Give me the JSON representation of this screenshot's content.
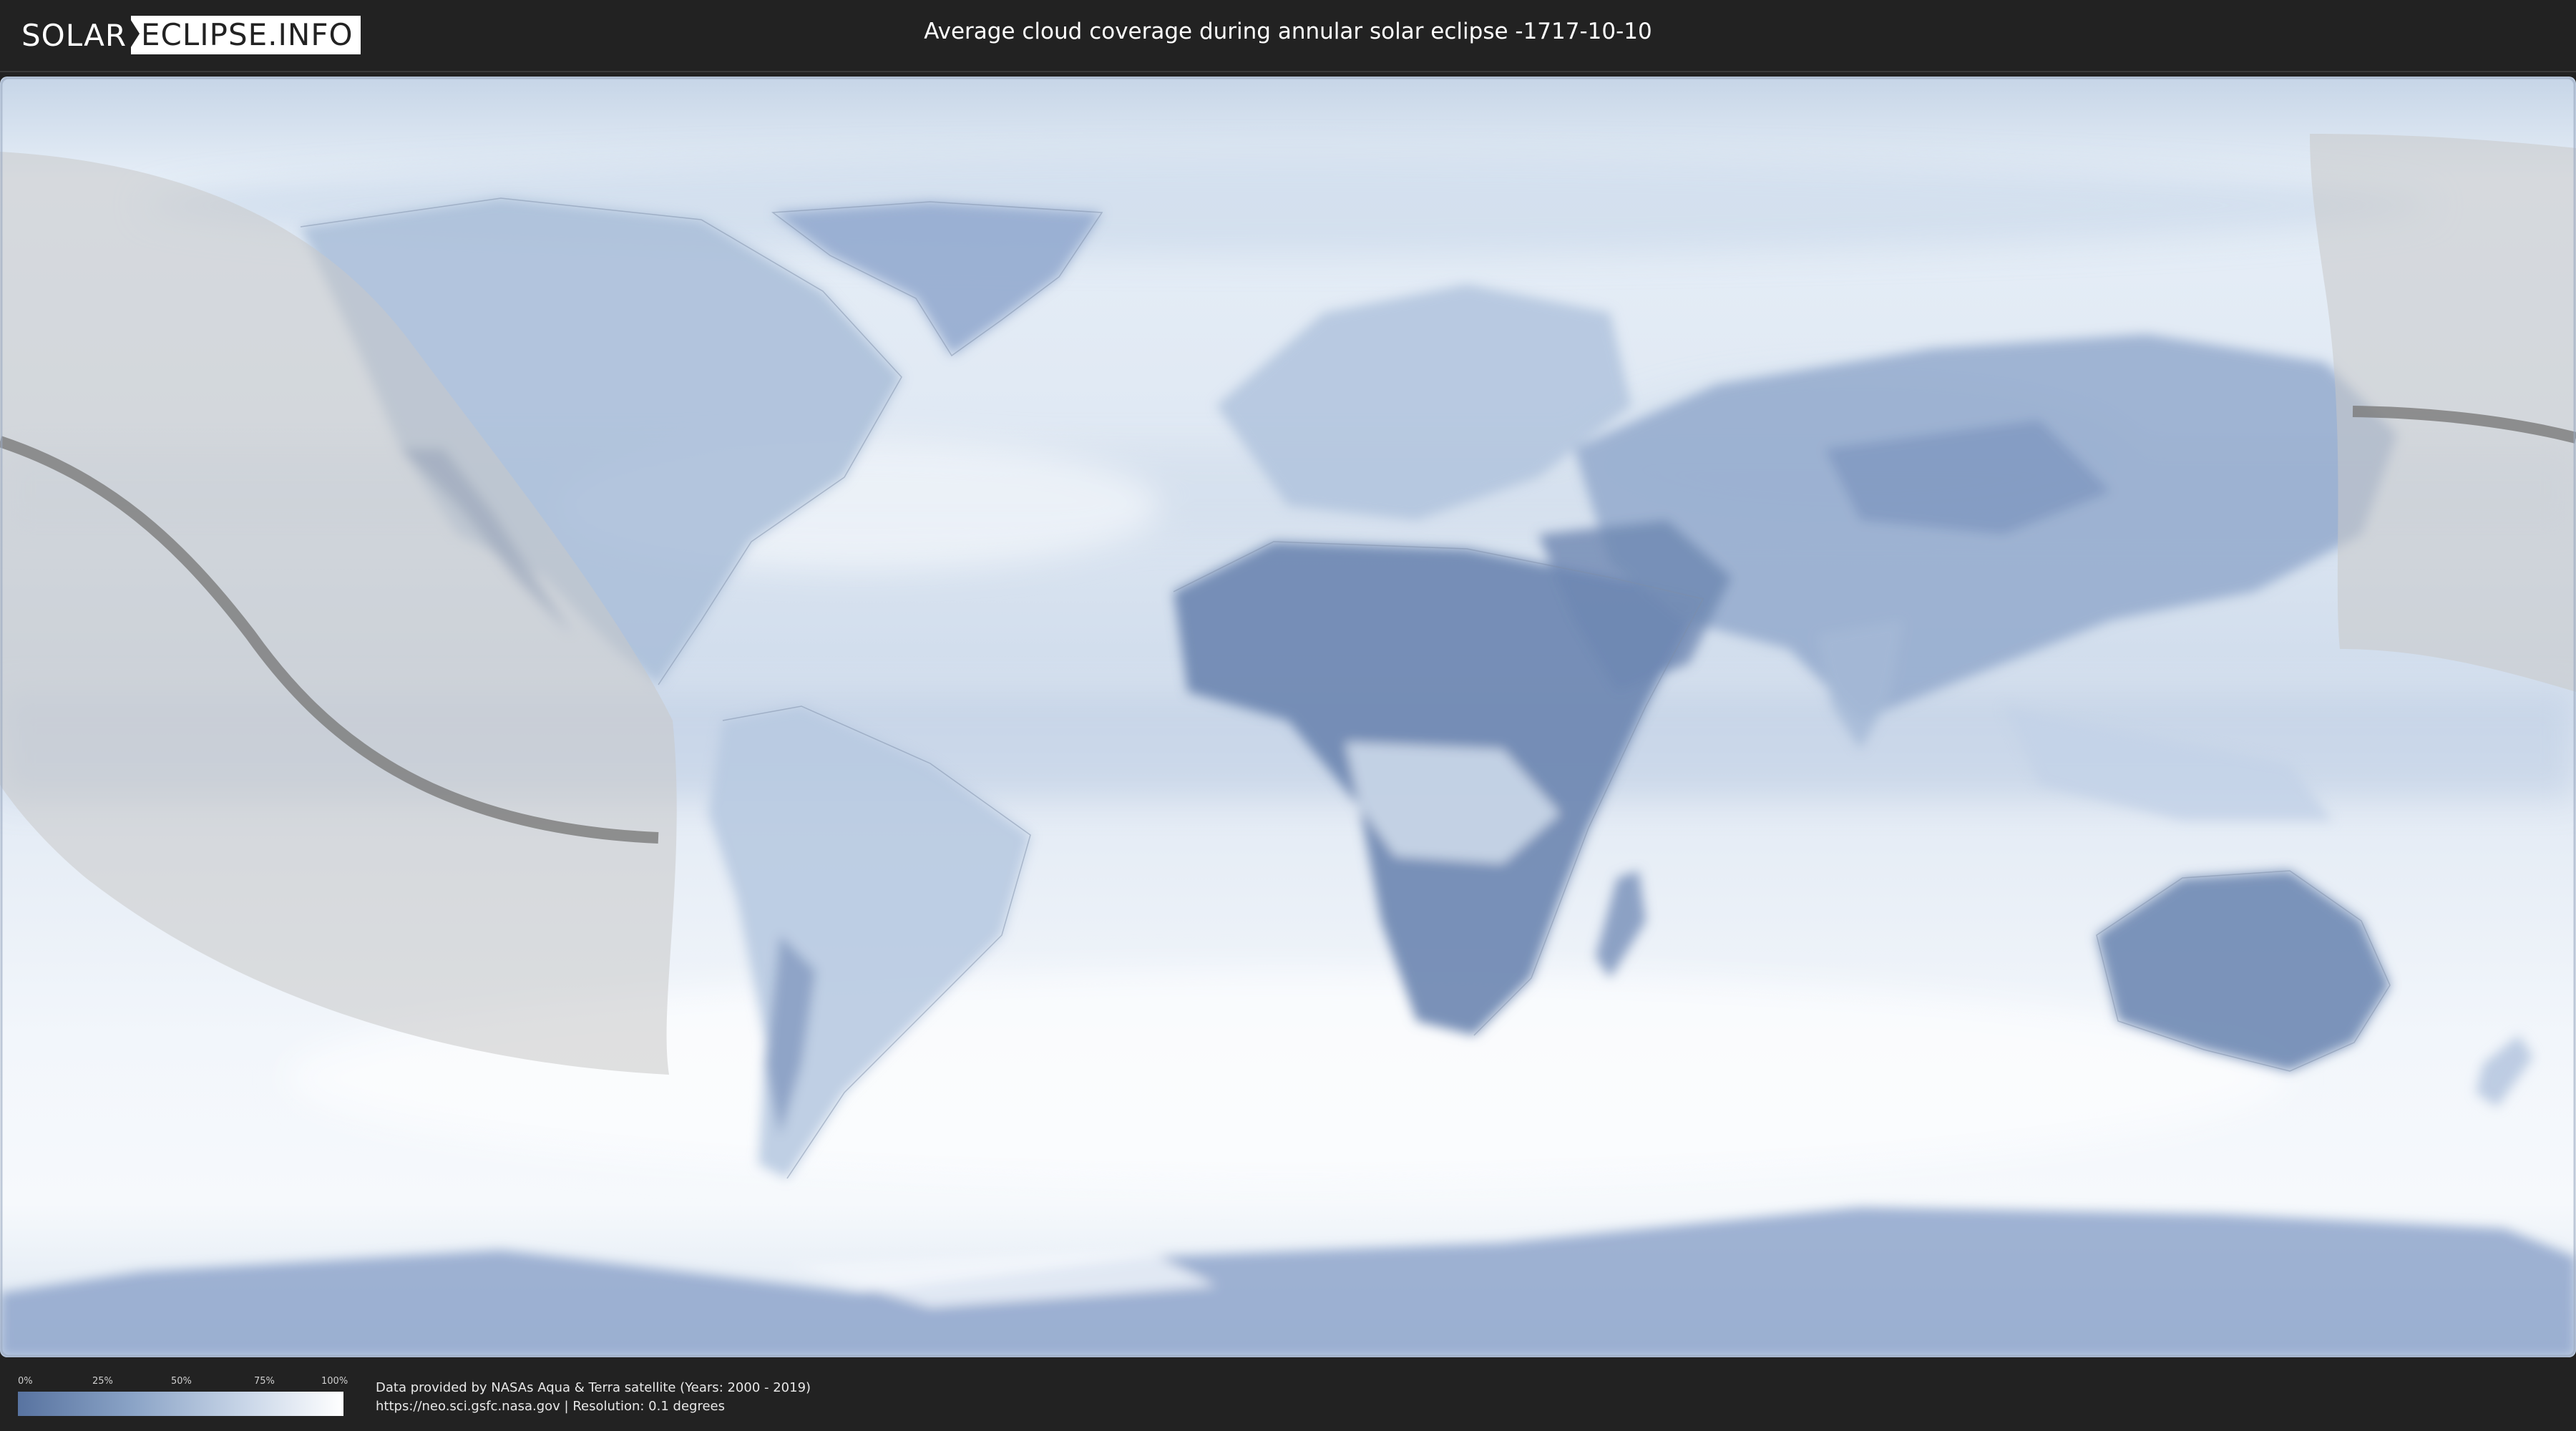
{
  "header": {
    "logo_part1": "SOLAR",
    "logo_part2": "ECLIPSE.INFO",
    "title": "Average cloud coverage during annular solar eclipse -1717-10-10"
  },
  "legend": {
    "ticks": [
      "0%",
      "25%",
      "50%",
      "75%",
      "100%"
    ],
    "colors": {
      "low": "#5873a0",
      "mid": "#c9d6e8",
      "high": "#ffffff"
    }
  },
  "footer": {
    "source_line1": "Data provided by NASAs Aqua & Terra satellite (Years: 2000 - 2019)",
    "source_line2": "https://neo.sci.gsfc.nasa.gov | Resolution: 0.1 degrees"
  },
  "map": {
    "colors": {
      "ocean_cloud": "#e4ecf5",
      "land_clear": "#6d86b0",
      "eclipse_zone": "#c8c8c8",
      "central_line": "#7a7a7a"
    },
    "layers": [
      "cloud-coverage-raster",
      "country-borders",
      "eclipse-visibility-zone",
      "central-line"
    ]
  }
}
